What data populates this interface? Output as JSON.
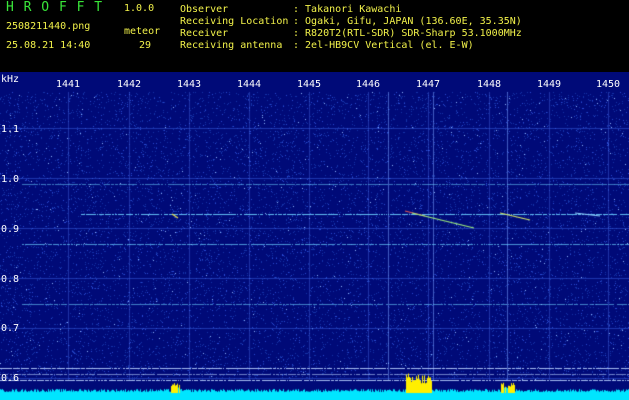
{
  "app": {
    "title": "H R O F F T",
    "version": "1.0.0",
    "filename": "2508211440.png",
    "datetime": "25.08.21 14:40",
    "meteor_label": "meteor",
    "meteor_count": "29"
  },
  "info": {
    "observer_label": "Observer",
    "observer_value": ": Takanori Kawachi",
    "location_label": "Receiving Location",
    "location_value": ": Ogaki, Gifu, JAPAN (136.60E, 35.35N)",
    "receiver_label": "Receiver",
    "receiver_value": ": R820T2(RTL-SDR) SDR-Sharp 53.1000MHz",
    "antenna_label": "Receiving antenna",
    "antenna_value": ": 2el-HB9CV Vertical (el. E-W)"
  },
  "axis": {
    "y_unit": "kHz",
    "x_ticks": [
      "1441",
      "1442",
      "1443",
      "1444",
      "1445",
      "1446",
      "1447",
      "1448",
      "1449",
      "1450"
    ],
    "y_ticks": [
      "1.1",
      "1.0",
      "0.9",
      "0.8",
      "0.7",
      "0.6"
    ]
  },
  "colors": {
    "title": "#39e639",
    "info_text": "#f2f24a",
    "background": "#000000",
    "spectrogram_bg": "#000a78",
    "noise": "#2a4bd4",
    "signal": "#6ad0ff",
    "baseline": "#00e5ff",
    "peak": "#ffef00"
  }
}
